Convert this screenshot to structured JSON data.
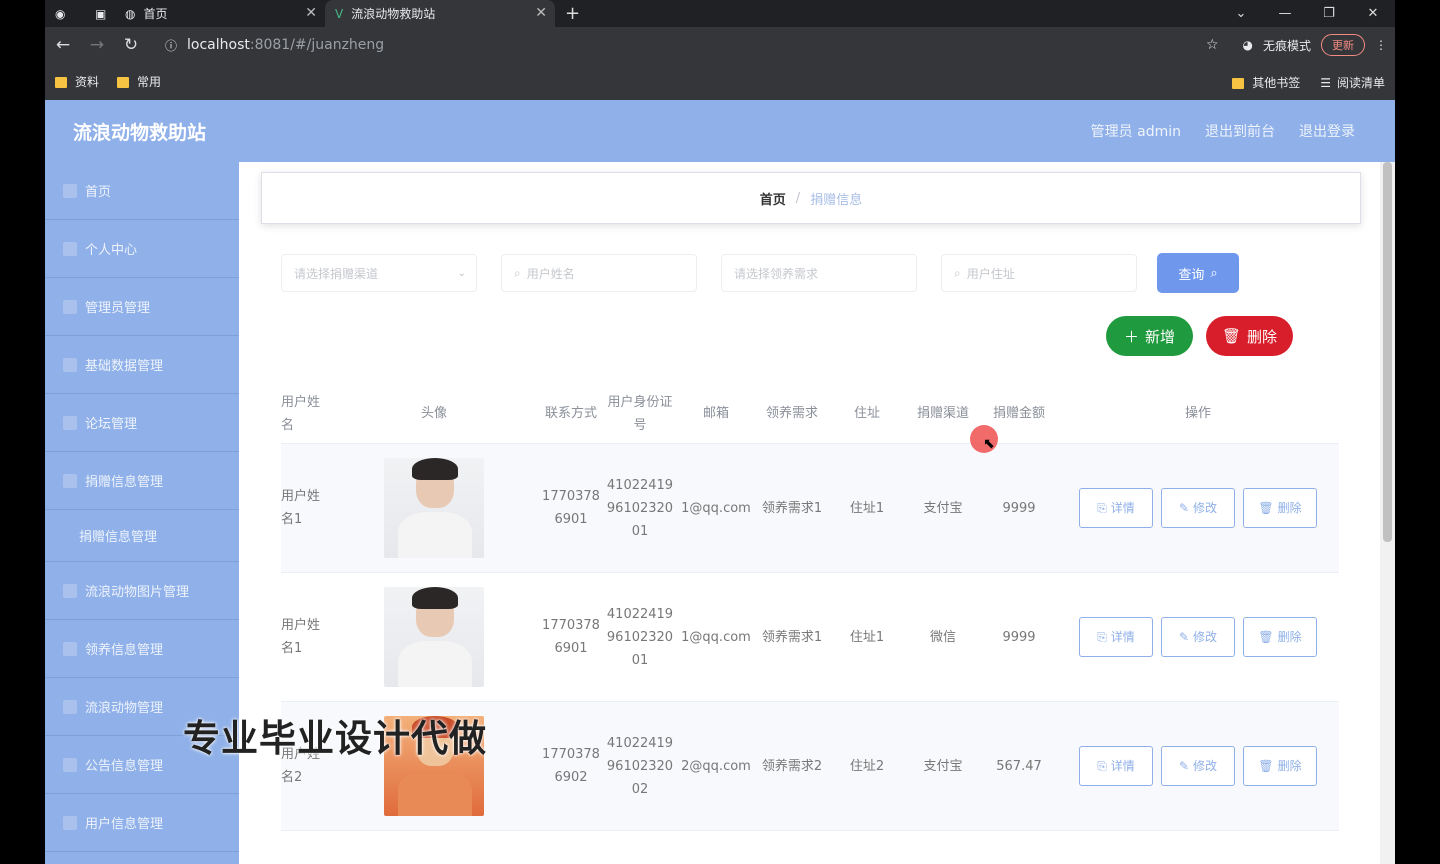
{
  "browser": {
    "tabs": [
      {
        "label": "首页",
        "active": false
      },
      {
        "label": "流浪动物救助站",
        "active": true
      }
    ],
    "new_tab": "+",
    "url_host": "localhost",
    "url_path": ":8081/#/juanzheng",
    "guest_mode": "无痕模式",
    "update_label": "更新",
    "bookmarks": [
      "资料",
      "常用"
    ],
    "bookmarks_right": [
      "其他书签",
      "阅读清单"
    ]
  },
  "app": {
    "brand": "流浪动物救助站",
    "header_links": [
      "管理员 admin",
      "退出到前台",
      "退出登录"
    ],
    "sidebar": [
      {
        "label": "首页",
        "sub": false
      },
      {
        "label": "个人中心",
        "sub": false
      },
      {
        "label": "管理员管理",
        "sub": false
      },
      {
        "label": "基础数据管理",
        "sub": false
      },
      {
        "label": "论坛管理",
        "sub": false
      },
      {
        "label": "捐赠信息管理",
        "sub": false
      },
      {
        "label": "捐赠信息管理",
        "sub": true
      },
      {
        "label": "流浪动物图片管理",
        "sub": false
      },
      {
        "label": "领养信息管理",
        "sub": false
      },
      {
        "label": "流浪动物管理",
        "sub": false
      },
      {
        "label": "公告信息管理",
        "sub": false
      },
      {
        "label": "用户信息管理",
        "sub": false
      }
    ],
    "breadcrumb": {
      "home": "首页",
      "sep": "/",
      "current": "捐赠信息"
    },
    "search": {
      "select_placeholder": "请选择捐赠渠道",
      "input1_placeholder": "用户姓名",
      "input2_placeholder": "请选择领养需求",
      "input3_placeholder": "用户住址",
      "query_label": "查询"
    },
    "add_label": "新增",
    "delete_label": "删除",
    "columns": [
      "用户姓名",
      "头像",
      "联系方式",
      "用户身份证号",
      "邮箱",
      "领养需求",
      "住址",
      "捐赠渠道",
      "捐赠金额",
      "操作"
    ],
    "rows": [
      {
        "name": "用户姓名1",
        "phone": "17703786901",
        "idcard": "410224199610232001",
        "email": "1@qq.com",
        "need": "领养需求1",
        "addr": "住址1",
        "channel": "支付宝",
        "amount": "9999",
        "avatar": "boy"
      },
      {
        "name": "用户姓名1",
        "phone": "17703786901",
        "idcard": "410224199610232001",
        "email": "1@qq.com",
        "need": "领养需求1",
        "addr": "住址1",
        "channel": "微信",
        "amount": "9999",
        "avatar": "boy"
      },
      {
        "name": "用户姓名2",
        "phone": "17703786902",
        "idcard": "410224199610232002",
        "email": "2@qq.com",
        "need": "领养需求2",
        "addr": "住址2",
        "channel": "支付宝",
        "amount": "567.47",
        "avatar": "orange"
      }
    ],
    "op_labels": {
      "detail": "详情",
      "edit": "修改",
      "delete": "删除"
    },
    "watermark": "专业毕业设计代做"
  }
}
